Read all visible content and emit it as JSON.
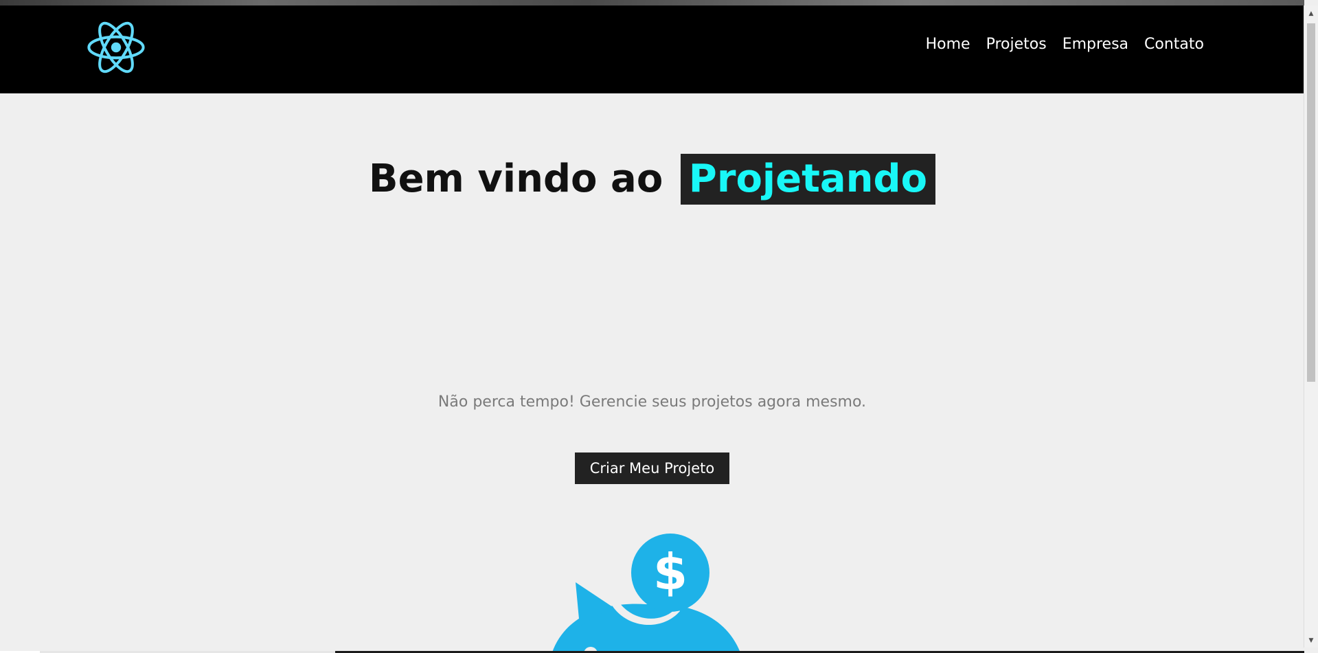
{
  "navbar": {
    "logo_icon": "react-atom-icon",
    "links": [
      {
        "label": "Home"
      },
      {
        "label": "Projetos"
      },
      {
        "label": "Empresa"
      },
      {
        "label": "Contato"
      }
    ]
  },
  "hero": {
    "title_prefix": "Bem vindo ao",
    "title_brand": "Projetando",
    "subtitle": "Não perca tempo! Gerencie seus projetos agora mesmo.",
    "cta_label": "Criar Meu Projeto",
    "illustration_icon": "piggy-bank-dollar-icon"
  },
  "colors": {
    "navbar_bg": "#000000",
    "page_bg": "#efefef",
    "brand_text": "#19f7f7",
    "brand_bg": "#222222",
    "logo": "#61dafb",
    "illustration": "#1eb2e8"
  }
}
